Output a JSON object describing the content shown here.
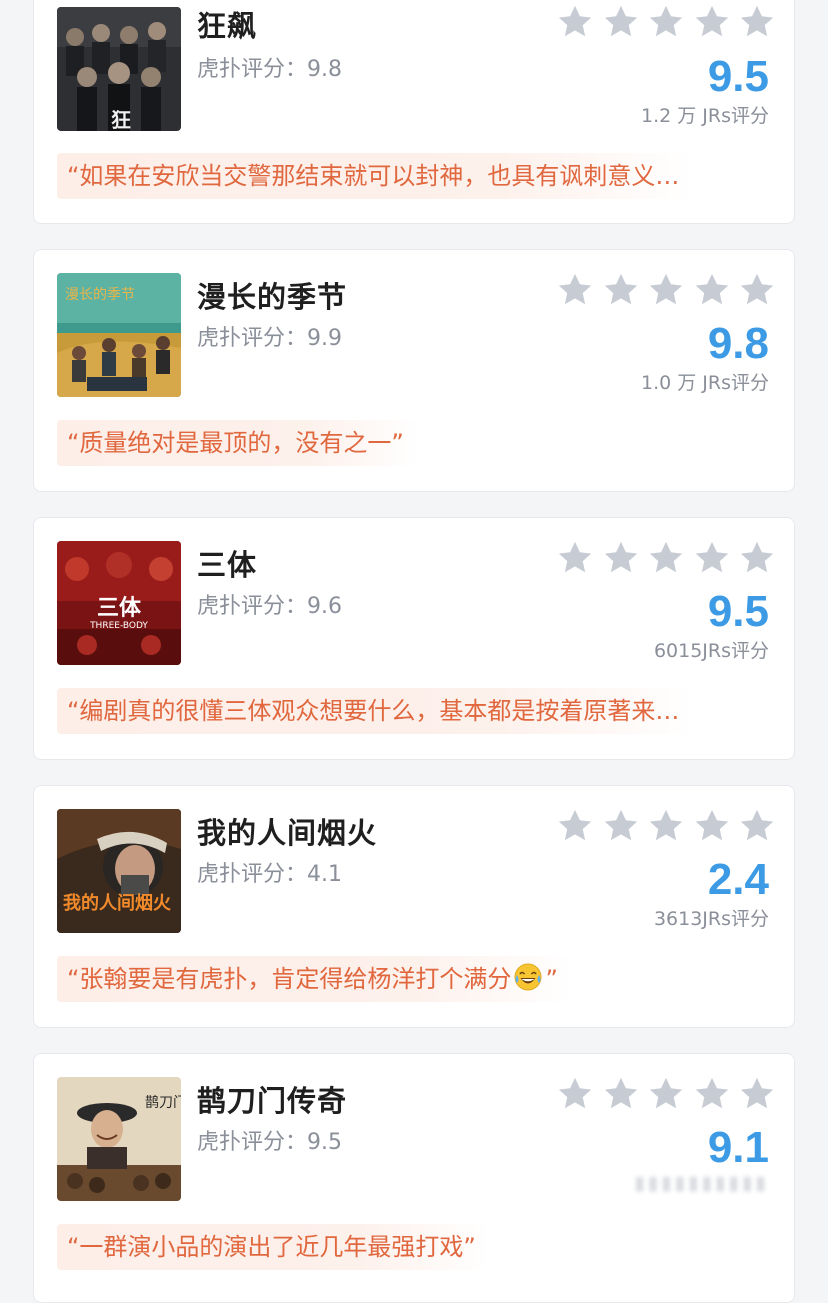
{
  "colors": {
    "score": "#3c9be4",
    "quote_text": "#e0673e",
    "quote_bg": "#fdeee8",
    "star_empty": "#c7cbd3"
  },
  "cards": [
    {
      "title": "狂飙",
      "hupu_label": "虎扑评分：",
      "hupu_score": "9.8",
      "score": "9.5",
      "count": "1.2 万 JRs评分",
      "quote": "“如果在安欣当交警那结束就可以封神，也具有讽刺意义…",
      "poster_caption": "狂",
      "stars_filled": 0
    },
    {
      "title": "漫长的季节",
      "hupu_label": "虎扑评分：",
      "hupu_score": "9.9",
      "score": "9.8",
      "count": "1.0 万 JRs评分",
      "quote": "“质量绝对是最顶的，没有之一”",
      "poster_caption": "漫长的季节",
      "stars_filled": 0
    },
    {
      "title": "三体",
      "hupu_label": "虎扑评分：",
      "hupu_score": "9.6",
      "score": "9.5",
      "count": "6015JRs评分",
      "quote": "“编剧真的很懂三体观众想要什么，基本都是按着原著来…",
      "poster_caption": "三体",
      "poster_subcaption": "THREE-BODY",
      "stars_filled": 0
    },
    {
      "title": "我的人间烟火",
      "hupu_label": "虎扑评分：",
      "hupu_score": "4.1",
      "score": "2.4",
      "count": "3613JRs评分",
      "quote": "“张翰要是有虎扑，肯定得给杨洋打个满分",
      "quote_tail": "”",
      "quote_emoji": "tears-of-joy-emoji",
      "poster_caption": "我的人间烟火",
      "stars_filled": 0
    },
    {
      "title": "鹊刀门传奇",
      "hupu_label": "虎扑评分：",
      "hupu_score": "9.5",
      "score": "9.1",
      "count": "",
      "quote": "“一群演小品的演出了近几年最强打戏”",
      "poster_caption": "鹊刀门传奇",
      "stars_filled": 0
    }
  ]
}
